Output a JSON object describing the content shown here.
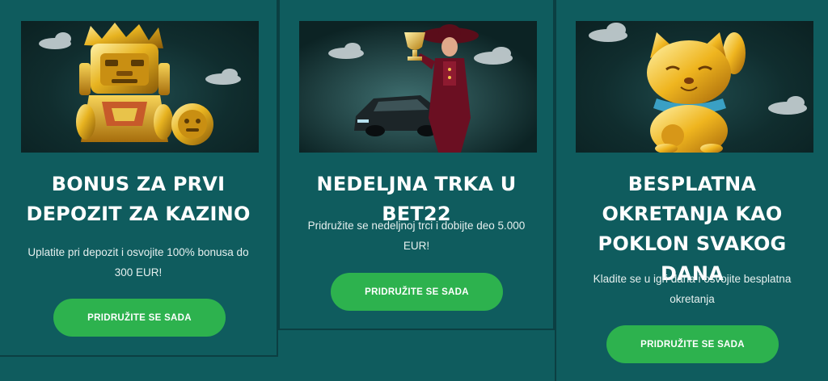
{
  "cards": [
    {
      "title": "BONUS ZA PRVI DEPOZIT ZA KAZINO",
      "description": "Uplatite pri depozit i osvojite 100% bonusa do 300 EUR!",
      "button_label": "PRIDRUŽITE SE SADA",
      "image": "golden-idol-with-coin"
    },
    {
      "title": "NEDELJNA TRKA U BET22",
      "description": "Pridružite se nedeljnoj trci i dobijte deo 5.000 EUR!",
      "button_label": "PRIDRUŽITE SE SADA",
      "image": "woman-with-trophy-and-car"
    },
    {
      "title": "BESPLATNA OKRETANJA KAO POKLON SVAKOG DANA",
      "description": "Kladite se u igri dana i osvojite besplatna okretanja",
      "button_label": "PRIDRUŽITE SE SADA",
      "image": "golden-lucky-cat"
    }
  ],
  "colors": {
    "background": "#0f5c5e",
    "button": "#2db24e",
    "card_border": "#0b3f42",
    "text": "#ffffff"
  }
}
